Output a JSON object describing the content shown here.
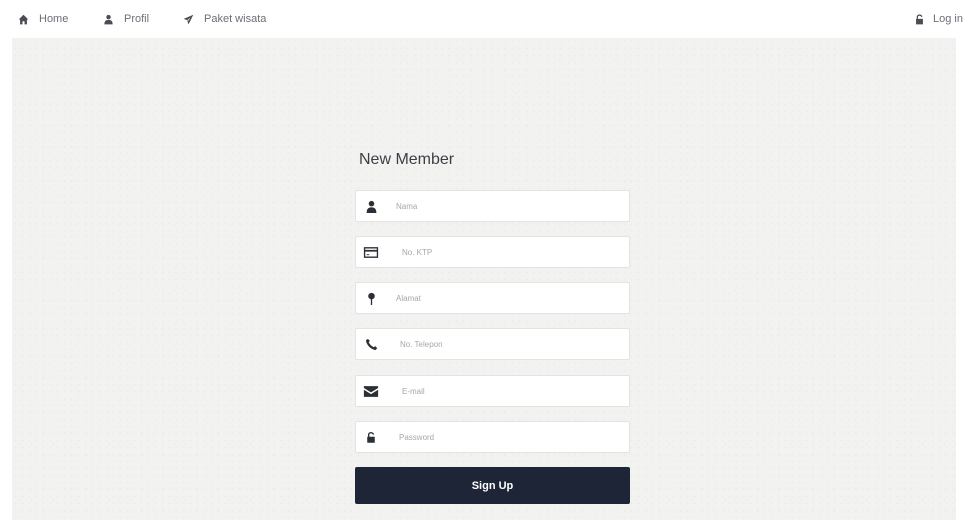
{
  "nav": {
    "items": [
      {
        "label": "Home",
        "icon": "home-icon"
      },
      {
        "label": "Profil",
        "icon": "user-icon"
      },
      {
        "label": "Paket wisata",
        "icon": "plane-icon"
      }
    ],
    "login": {
      "label": "Log in",
      "icon": "unlock-icon"
    }
  },
  "form": {
    "title": "New Member",
    "fields": [
      {
        "placeholder": "Nama",
        "icon": "user-icon"
      },
      {
        "placeholder": "No. KTP",
        "icon": "credit-card-icon"
      },
      {
        "placeholder": "Alamat",
        "icon": "map-pin-icon"
      },
      {
        "placeholder": "No. Telepon",
        "icon": "phone-icon"
      },
      {
        "placeholder": "E-mail",
        "icon": "envelope-icon"
      },
      {
        "placeholder": "Password",
        "icon": "unlock-icon"
      }
    ],
    "submit_label": "Sign Up"
  },
  "colors": {
    "button_bg": "#1e2536",
    "content_bg": "#f2f2f1",
    "nav_text": "#6b6f75"
  }
}
